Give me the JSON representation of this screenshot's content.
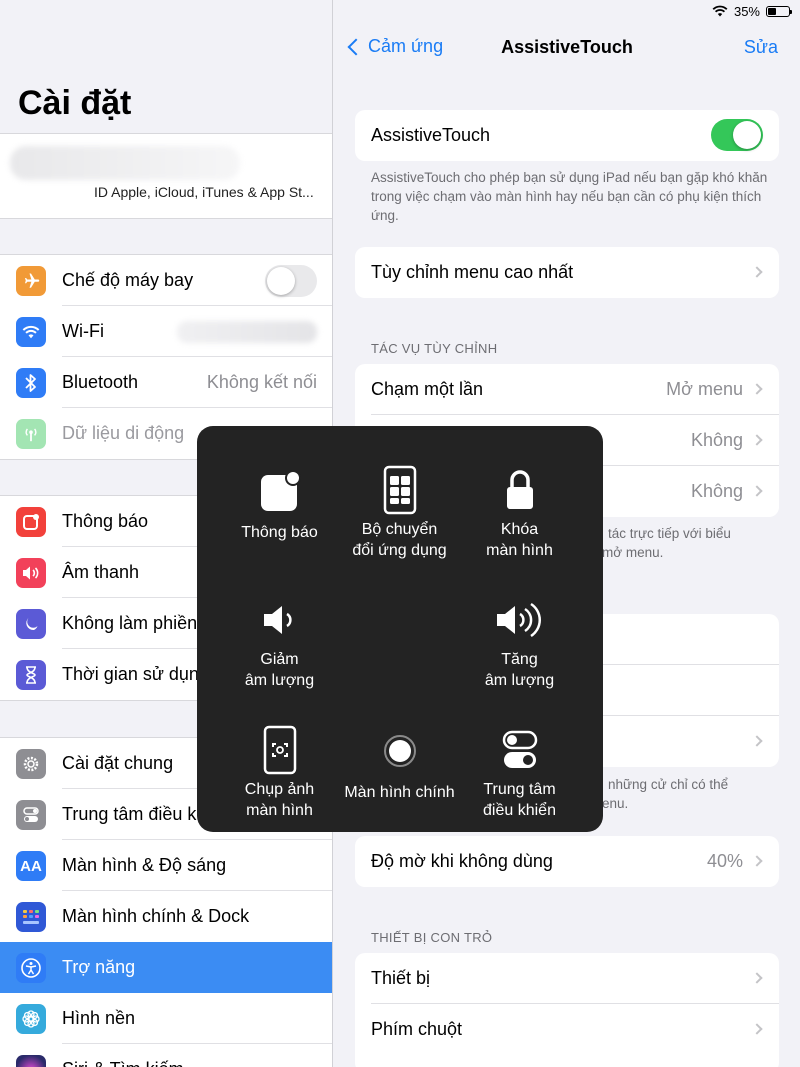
{
  "status_bar": {
    "battery": "35%",
    "battery_level": 0.35
  },
  "left_pane": {
    "title": "Cài đặt",
    "profile": {
      "subtitle": "ID Apple, iCloud, iTunes & App St..."
    },
    "groups": [
      [
        {
          "label": "Chế độ máy bay",
          "icon": "airplane-icon",
          "color": "#f19a37",
          "toggle": false
        },
        {
          "label": "Wi-Fi",
          "icon": "wifi-icon",
          "color": "#2f7cf6",
          "value": ""
        },
        {
          "label": "Bluetooth",
          "icon": "bluetooth-icon",
          "color": "#2f7cf6",
          "value": "Không kết nối"
        },
        {
          "label": "Dữ liệu di động",
          "icon": "antenna-icon",
          "color": "#34c759",
          "dimmed": true
        }
      ],
      [
        {
          "label": "Thông báo",
          "icon": "notifications-icon",
          "color": "#f2413b"
        },
        {
          "label": "Âm thanh",
          "icon": "speaker-icon",
          "color": "#f2415a"
        },
        {
          "label": "Không làm phiền",
          "icon": "moon-icon",
          "color": "#5b5ad6"
        },
        {
          "label": "Thời gian sử dụng",
          "icon": "hourglass-icon",
          "color": "#5b5ad6"
        }
      ],
      [
        {
          "label": "Cài đặt chung",
          "icon": "gear-icon",
          "color": "#8e8e93"
        },
        {
          "label": "Trung tâm điều khiển",
          "icon": "control-center-icon",
          "color": "#8e8e93"
        },
        {
          "label": "Màn hình & Độ sáng",
          "icon": "display-aa-icon",
          "color": "#2f7cf6"
        },
        {
          "label": "Màn hình chính & Dock",
          "icon": "home-grid-icon",
          "color": "#2f58d6"
        },
        {
          "label": "Trợ năng",
          "icon": "accessibility-icon",
          "color": "#2f7cf6",
          "selected": true
        },
        {
          "label": "Hình nền",
          "icon": "wallpaper-flower-icon",
          "color": "#35aadc"
        },
        {
          "label": "Siri & Tìm kiếm",
          "icon": "siri-icon",
          "color": "#222"
        }
      ]
    ]
  },
  "right_pane": {
    "nav": {
      "back_label": "Cảm ứng",
      "title": "AssistiveTouch",
      "edit_label": "Sửa"
    },
    "assistivetouch": {
      "label": "AssistiveTouch",
      "on": true
    },
    "assistivetouch_note": "AssistiveTouch cho phép bạn sử dụng iPad nếu bạn gặp khó khăn trong việc chạm vào màn hình hay nếu bạn cần có phụ kiện thích ứng.",
    "customize_label": "Tùy chỉnh menu cao nhất",
    "custom_actions_header": "TÁC VỤ TÙY CHỈNH",
    "custom_actions": [
      {
        "label": "Chạm một lần",
        "value": "Mở menu"
      },
      {
        "label": "",
        "value": "Không"
      },
      {
        "label": "",
        "value": "Không"
      }
    ],
    "custom_actions_note_tail_1": "tác trực tiếp với biểu",
    "custom_actions_note_tail_2": "mở menu.",
    "gestures_note_tail_1": "những cử chỉ có thể",
    "gestures_note_tail_2": "enu.",
    "idle_opacity": {
      "label": "Độ mờ khi không dùng",
      "value": "40%"
    },
    "pointer_header": "THIẾT BỊ CON TRỎ",
    "pointer_items": [
      {
        "label": "Thiết bị"
      },
      {
        "label": "Phím chuột"
      }
    ]
  },
  "assistive_menu": {
    "items": [
      {
        "label": "Thông báo",
        "icon": "notification-badge-icon"
      },
      {
        "label": "Bộ chuyển\nđổi ứng dụng",
        "icon": "app-switcher-icon"
      },
      {
        "label": "Khóa\nmàn hình",
        "icon": "lock-icon"
      },
      {
        "label": "Giảm\nâm lượng",
        "icon": "volume-down-icon"
      },
      {
        "label": "Tăng\nâm lượng",
        "icon": "volume-up-icon"
      },
      {
        "label": "Chụp ảnh\nmàn hình",
        "icon": "screenshot-icon"
      },
      {
        "label": "Màn hình chính",
        "icon": "home-button-icon"
      },
      {
        "label": "Trung tâm\nđiều khiển",
        "icon": "control-toggles-icon"
      }
    ]
  }
}
